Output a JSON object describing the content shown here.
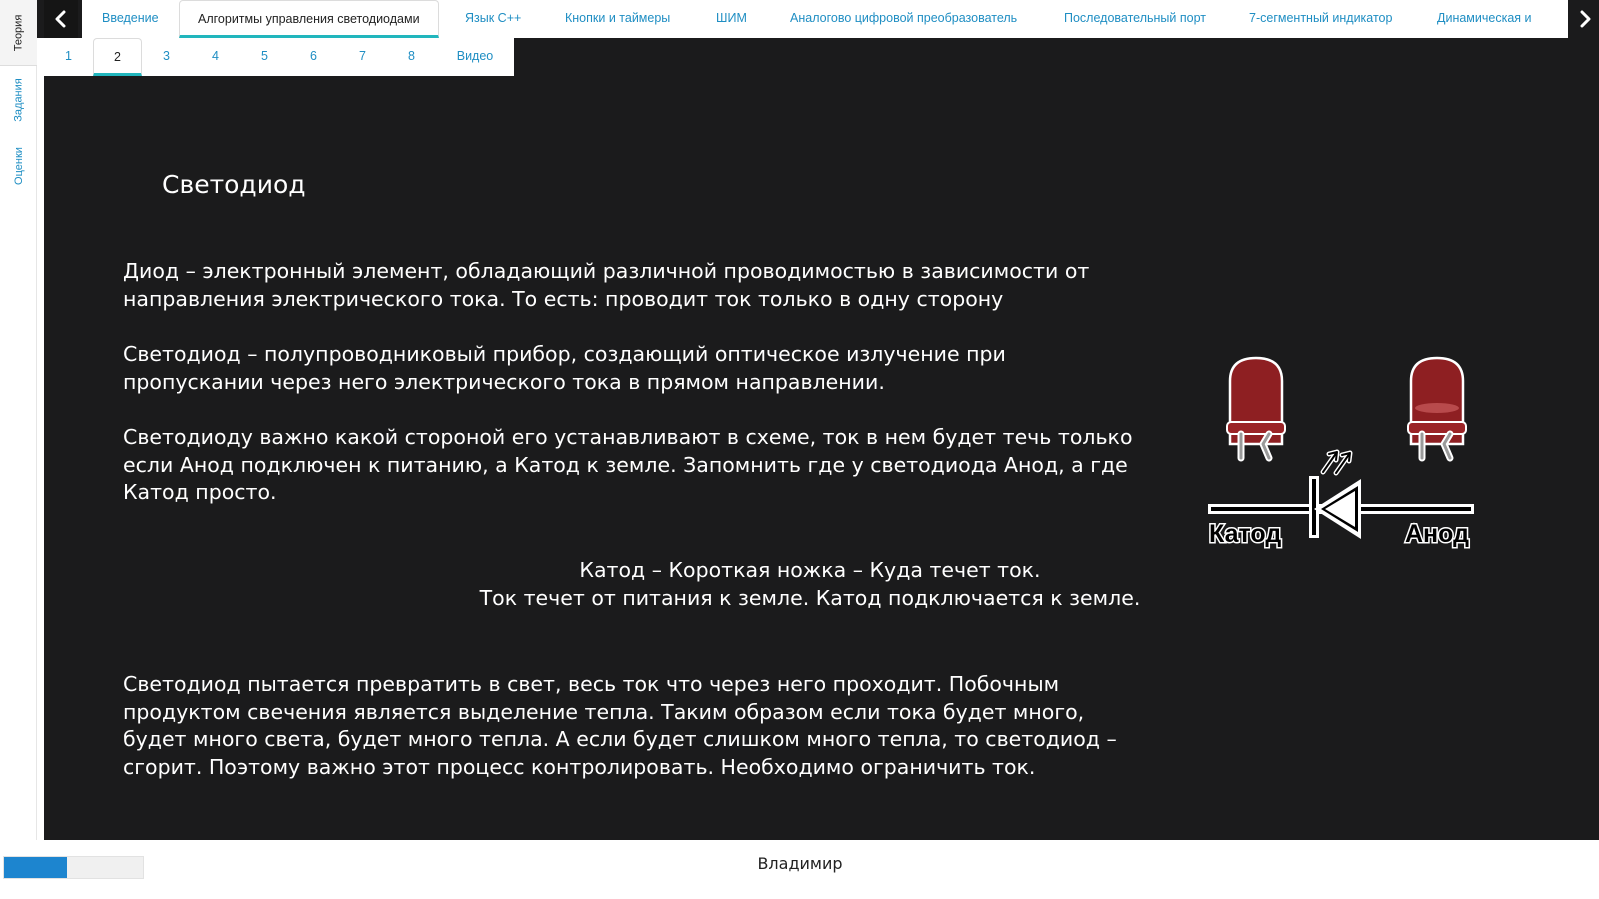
{
  "side_tabs": [
    {
      "label": "Теория"
    },
    {
      "label": "Задания"
    },
    {
      "label": "Оценки"
    }
  ],
  "top_tabs": [
    {
      "label": "Введение"
    },
    {
      "label": "Алгоритмы управления светодиодами"
    },
    {
      "label": "Язык C++"
    },
    {
      "label": "Кнопки и таймеры"
    },
    {
      "label": "ШИМ"
    },
    {
      "label": "Аналогово цифровой преобразователь"
    },
    {
      "label": "Последовательный порт"
    },
    {
      "label": "7-сегментный индикатор"
    },
    {
      "label": "Динамическая и"
    }
  ],
  "active_top_tab": 1,
  "sub_tabs": [
    "1",
    "2",
    "3",
    "4",
    "5",
    "6",
    "7",
    "8",
    "Видео"
  ],
  "active_sub_tab": 1,
  "content": {
    "title": "Светодиод",
    "p1": "Диод – электронный элемент, обладающий различной проводимостью в зависимости от направления электрического тока. То есть: проводит ток только в одну сторону",
    "p2": "Светодиод – полупроводниковый прибор, создающий оптическое излучение при пропускании через него электрического тока в прямом направлении.",
    "p3": "Светодиоду важно какой стороной его устанавливают в схеме, ток в нем будет течь только если Анод подключен к питанию, а Катод к земле. Запомнить где у светодиода Анод, а где Катод просто.",
    "c1": "Катод – Короткая ножка – Куда течет ток.",
    "c2": "Ток течет от питания к земле. Катод подключается к земле.",
    "p4": "Светодиод пытается превратить в свет, весь ток что через него проходит. Побочным продуктом свечения является выделение тепла. Таким образом если тока будет много, будет много света, будет много тепла. А если будет слишком много тепла, то светодиод – сгорит. Поэтому важно этот процесс контролировать. Необходимо ограничить ток.",
    "figure": {
      "cathode_label": "Катод",
      "anode_label": "Анод",
      "led_color": "#8e1f22"
    }
  },
  "footer": {
    "progress": 0.45,
    "username": "Владимир"
  },
  "colors": {
    "accent": "#21b6bd",
    "link": "#1f8ec3",
    "dark_bg": "#1b1b1c"
  }
}
